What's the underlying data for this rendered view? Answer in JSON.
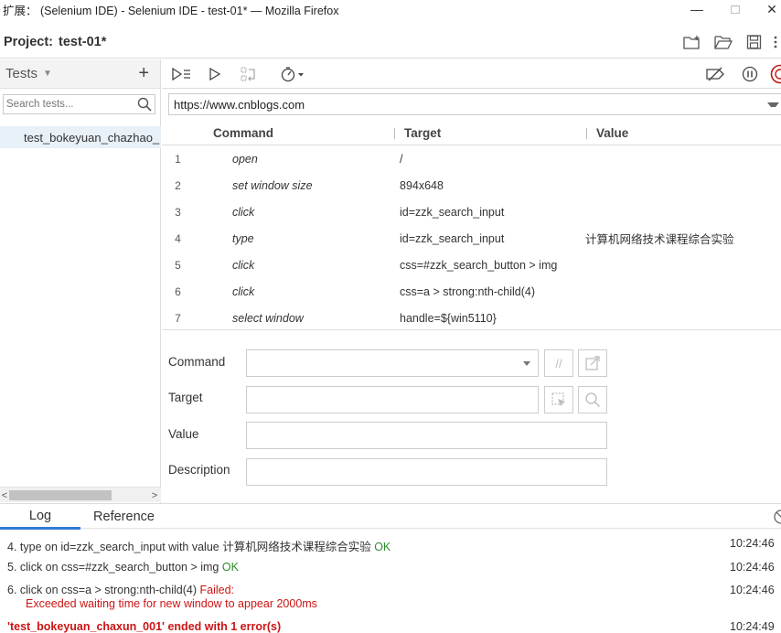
{
  "window": {
    "title": "扩展： (Selenium IDE) - Selenium IDE - test-01* — Mozilla Firefox",
    "minimize": "—",
    "maximize": "□",
    "close": "✕"
  },
  "project": {
    "label": "Project:",
    "name": "test-01*",
    "icons": [
      "new-folder-icon",
      "open-folder-icon",
      "save-icon",
      "more-icon"
    ]
  },
  "tests_panel": {
    "title": "Tests",
    "add": "+",
    "search_placeholder": "Search tests...",
    "items": [
      {
        "label": "test_bokeyuan_chazhao_"
      }
    ]
  },
  "toolbar": {
    "icons": [
      "run-all-tests-icon",
      "run-current-test-icon",
      "step-over-icon",
      "speed-icon",
      "disable-breakpoints-icon",
      "pause-icon",
      "record-icon"
    ]
  },
  "url": "https://www.cnblogs.com",
  "table": {
    "headers": {
      "command": "Command",
      "target": "Target",
      "value": "Value"
    },
    "rows": [
      {
        "num": "1",
        "command": "open",
        "target": "/",
        "value": ""
      },
      {
        "num": "2",
        "command": "set window size",
        "target": "894x648",
        "value": ""
      },
      {
        "num": "3",
        "command": "click",
        "target": "id=zzk_search_input",
        "value": ""
      },
      {
        "num": "4",
        "command": "type",
        "target": "id=zzk_search_input",
        "value": "计算机网络技术课程综合实验"
      },
      {
        "num": "5",
        "command": "click",
        "target": "css=#zzk_search_button > img",
        "value": ""
      },
      {
        "num": "6",
        "command": "click",
        "target": "css=a > strong:nth-child(4)",
        "value": ""
      },
      {
        "num": "7",
        "command": "select window",
        "target": "handle=${win5110}",
        "value": ""
      }
    ]
  },
  "editor": {
    "command_label": "Command",
    "target_label": "Target",
    "value_label": "Value",
    "description_label": "Description",
    "comment_btn": "//"
  },
  "log_tabs": {
    "log": "Log",
    "reference": "Reference"
  },
  "log": {
    "entries": [
      {
        "prefix": "4.  type on id=zzk_search_input with value 计算机网络技术课程综合实验 ",
        "status": "OK",
        "time": "10:24:46"
      },
      {
        "prefix": "5.  click on css=#zzk_search_button > img ",
        "status": "OK",
        "time": "10:24:46"
      },
      {
        "prefix": "6.  click on css=a > strong:nth-child(4) ",
        "status": "Failed:",
        "detail": "Exceeded waiting time for new window to appear 2000ms",
        "time": "10:24:46"
      }
    ],
    "summary": "'test_bokeyuan_chaxun_001' ended with 1 error(s)",
    "summary_time": "10:24:49"
  }
}
